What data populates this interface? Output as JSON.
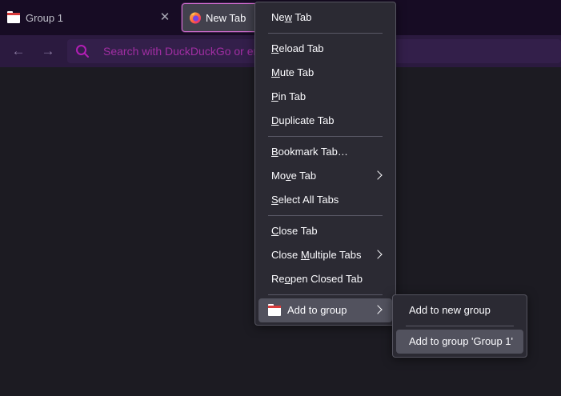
{
  "tabs": {
    "group_tab_label": "Group 1",
    "active_tab_label": "New Tab"
  },
  "urlbar": {
    "placeholder": "Search with DuckDuckGo or enter address"
  },
  "context_menu": {
    "items": [
      {
        "pre": "Ne",
        "u": "w",
        "post": " Tab"
      },
      {
        "pre": "",
        "u": "R",
        "post": "eload Tab"
      },
      {
        "pre": "",
        "u": "M",
        "post": "ute Tab"
      },
      {
        "pre": "",
        "u": "P",
        "post": "in Tab"
      },
      {
        "pre": "",
        "u": "D",
        "post": "uplicate Tab"
      },
      {
        "pre": "",
        "u": "B",
        "post": "ookmark Tab…"
      },
      {
        "pre": "Mo",
        "u": "v",
        "post": "e Tab"
      },
      {
        "pre": "",
        "u": "S",
        "post": "elect All Tabs"
      },
      {
        "pre": "",
        "u": "C",
        "post": "lose Tab"
      },
      {
        "pre": "Close ",
        "u": "M",
        "post": "ultiple Tabs"
      },
      {
        "pre": "Re",
        "u": "o",
        "post": "pen Closed Tab"
      },
      {
        "pre": "",
        "u": "",
        "post": "Add to group"
      }
    ]
  },
  "submenu": {
    "new_group": "Add to new group",
    "existing_group": "Add to group 'Group 1'"
  },
  "colors": {
    "accent": "#d46ed3",
    "group_color": "#d83b3b"
  }
}
